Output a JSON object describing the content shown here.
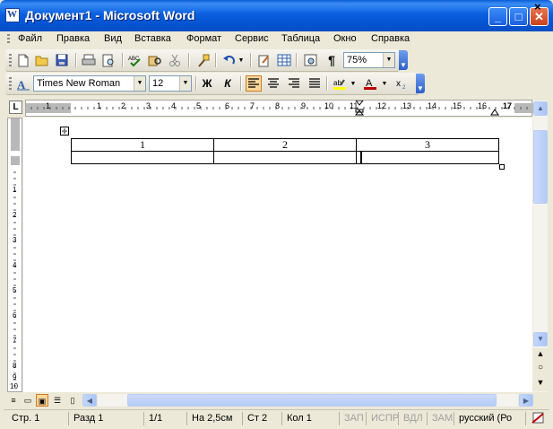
{
  "window": {
    "title": "Документ1 - Microsoft Word",
    "app_icon_letter": "W"
  },
  "window_controls": {
    "minimize": "_",
    "maximize": "□",
    "close": "✕"
  },
  "menu": {
    "items": [
      "Файл",
      "Правка",
      "Вид",
      "Вставка",
      "Формат",
      "Сервис",
      "Таблица",
      "Окно",
      "Справка"
    ],
    "close_doc": "×"
  },
  "toolbar_standard": {
    "zoom": "75%"
  },
  "toolbar_format": {
    "font_name": "Times New Roman",
    "font_size": "12",
    "bold": "Ж",
    "italic": "К"
  },
  "ruler": {
    "h_numbers": [
      "1",
      "1",
      "2",
      "3",
      "4",
      "5",
      "6",
      "7",
      "8",
      "9",
      "10",
      "11",
      "12",
      "13",
      "14",
      "15",
      "16",
      "17"
    ],
    "v_numbers": [
      "1",
      "2",
      "3",
      "4",
      "5",
      "6",
      "7",
      "8",
      "9",
      "10"
    ]
  },
  "table": {
    "rows": [
      [
        "1",
        "2",
        "3"
      ],
      [
        "",
        "",
        ""
      ]
    ]
  },
  "status": {
    "page": "Стр. 1",
    "section": "Разд 1",
    "pages": "1/1",
    "position": "На 2,5см",
    "line": "Ст 2",
    "column": "Кол 1",
    "rec": "ЗАП",
    "trk": "ИСПР",
    "ext": "ВДЛ",
    "ovr": "ЗАМ",
    "language": "русский (Ро"
  }
}
